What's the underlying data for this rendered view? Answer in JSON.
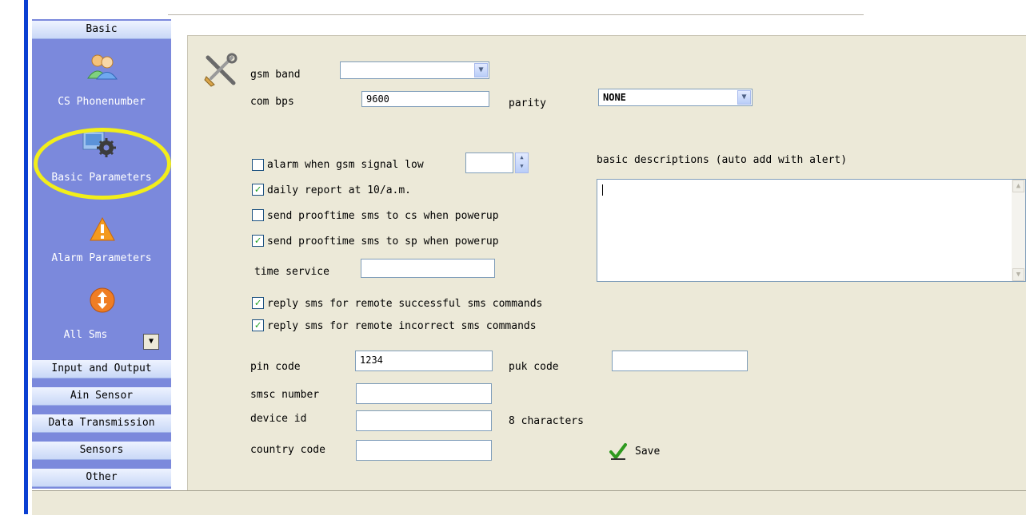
{
  "sidebar": {
    "header": "Basic",
    "items": [
      {
        "label": "CS Phonenumber",
        "icon": "users-icon"
      },
      {
        "label": "Basic Parameters",
        "icon": "settings-gear-icon"
      },
      {
        "label": "Alarm Parameters",
        "icon": "warning-icon"
      },
      {
        "label": "All Sms",
        "icon": "sms-arrows-icon"
      }
    ],
    "sections": [
      "Input and Output",
      "Ain Sensor",
      "Data Transmission",
      "Sensors",
      "Other"
    ]
  },
  "form": {
    "gsm_band_label": "gsm band",
    "gsm_band_value": "",
    "com_bps_label": "com bps",
    "com_bps_value": "9600",
    "parity_label": "parity",
    "parity_value": "NONE",
    "alarm_gsm_label": "alarm when gsm signal low",
    "alarm_gsm_checked": false,
    "alarm_gsm_value": "",
    "daily_report_label": "daily report at 10/a.m.",
    "daily_report_checked": true,
    "proof_cs_label": "send prooftime sms to cs when powerup",
    "proof_cs_checked": false,
    "proof_sp_label": "send prooftime sms to sp when powerup",
    "proof_sp_checked": true,
    "time_service_label": "time service",
    "time_service_value": "",
    "reply_success_label": "reply sms for remote successful sms commands",
    "reply_success_checked": true,
    "reply_incorrect_label": "reply sms for remote incorrect sms commands",
    "reply_incorrect_checked": true,
    "pin_label": "pin code",
    "pin_value": "1234",
    "puk_label": "puk code",
    "puk_value": "",
    "smsc_label": "smsc number",
    "smsc_value": "",
    "device_id_label": "device id",
    "device_id_value": "",
    "device_id_hint": "8 characters",
    "country_label": "country code",
    "country_value": "",
    "descriptions_label": "basic descriptions (auto add with alert)",
    "descriptions_value": "",
    "save_label": "Save"
  },
  "colors": {
    "sidebar_bg": "#7b89dc",
    "panel_bg": "#ece9d8",
    "highlight_ring": "#f2ee1a",
    "check_green": "#21a121"
  }
}
